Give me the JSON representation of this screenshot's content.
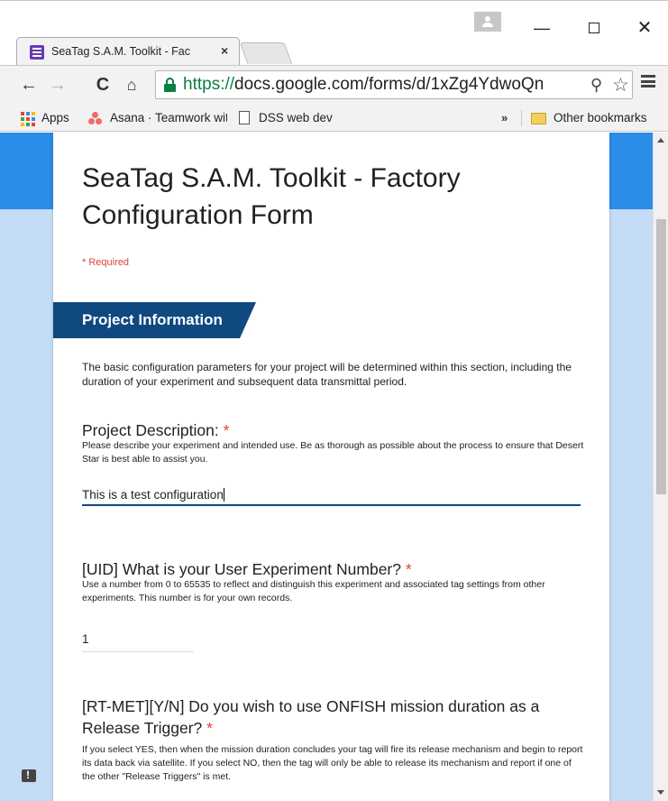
{
  "browser": {
    "tab_title": "SeaTag S.A.M. Toolkit - Fac",
    "tab_close": "×",
    "url_scheme": "https://",
    "url_rest": "docs.google.com/forms/d/1xZg4YdwoQn",
    "bookmarks": {
      "apps": "Apps",
      "asana": "Asana · Teamwork witl",
      "dss": "DSS  web dev",
      "overflow": "»",
      "other": "Other bookmarks"
    },
    "icons": {
      "back": "←",
      "forward": "→",
      "reload": "C",
      "home": "⌂",
      "zoom": "⚲",
      "star": "☆",
      "minimize": "—",
      "close": "✕"
    }
  },
  "form": {
    "title": "SeaTag S.A.M. Toolkit - Factory Configuration Form",
    "required_note": "* Required",
    "section": {
      "title": "Project Information",
      "description": "The basic configuration parameters for your project will be determined within this section, including the duration of your experiment and subsequent data transmittal period."
    },
    "questions": [
      {
        "title": "Project Description:",
        "required_mark": "*",
        "help": "Please describe your experiment and intended use. Be as thorough as possible about the process to ensure that Desert Star is best able to assist you.",
        "value": "This is a test configuration"
      },
      {
        "title": "[UID] What is your User Experiment Number?",
        "required_mark": "*",
        "help": "Use a number from 0 to 65535 to reflect and distinguish this experiment and associated tag settings from other experiments. This number is for your own records.",
        "value": "1"
      },
      {
        "title": "[RT-MET][Y/N] Do you wish to use ONFISH mission duration as a Release Trigger?",
        "required_mark": "*",
        "help": "If you select YES, then when the mission duration concludes your tag will fire its release mechanism and begin to report its data back via satellite. If you select NO, then the tag will only be able to release its mechanism and report if one of the other \"Release Triggers\" is met."
      }
    ]
  }
}
